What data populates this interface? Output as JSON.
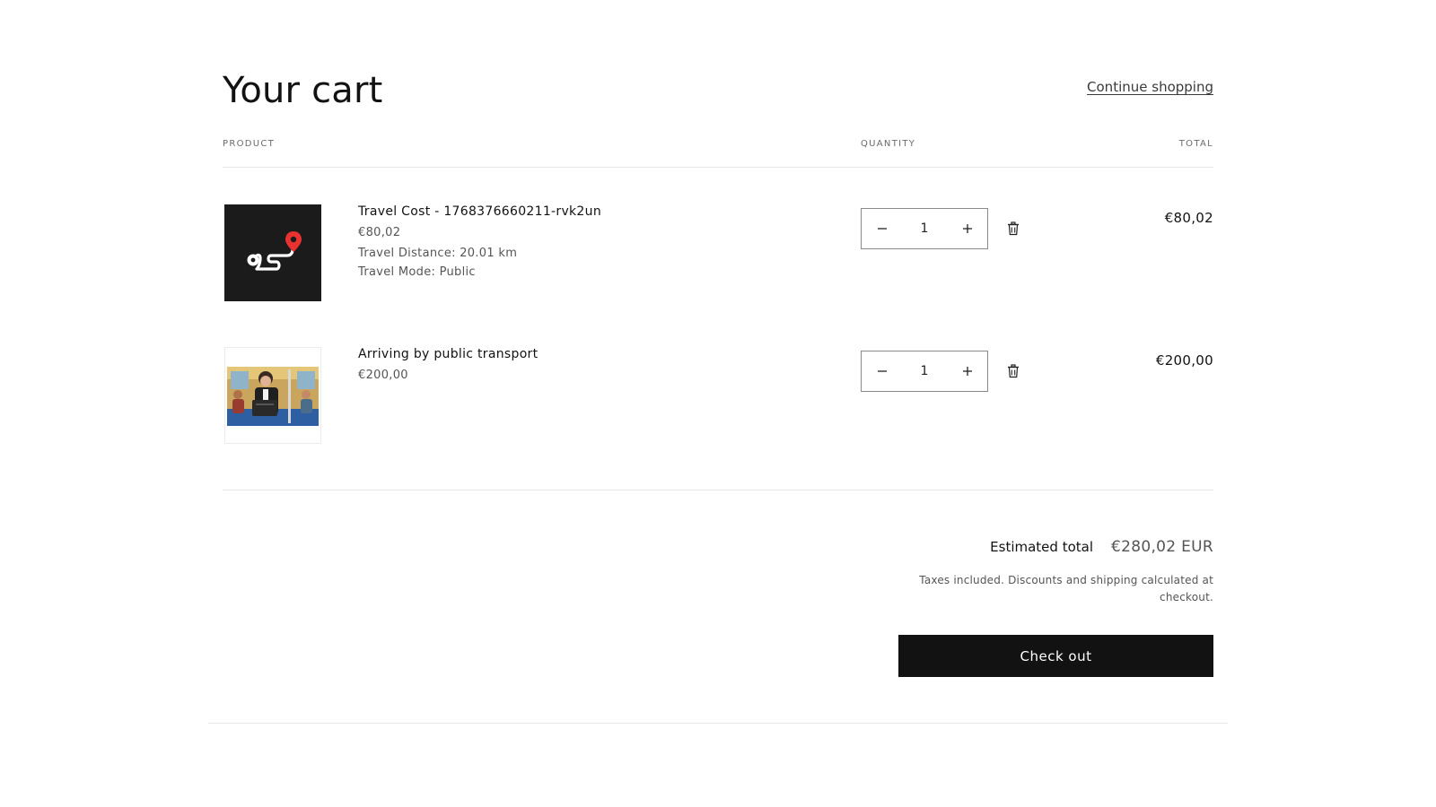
{
  "header": {
    "title": "Your cart",
    "continue_label": "Continue shopping"
  },
  "columns": {
    "product": "Product",
    "quantity": "Quantity",
    "total": "Total"
  },
  "items": [
    {
      "name": "Travel Cost - 1768376660211-rvk2un",
      "price": "€80,02",
      "properties": [
        "Travel Distance: 20.01 km",
        "Travel Mode: Public"
      ],
      "quantity": "1",
      "line_total": "€80,02",
      "image_icon": "route-pin-icon"
    },
    {
      "name": "Arriving by public transport",
      "price": "€200,00",
      "properties": [],
      "quantity": "1",
      "line_total": "€200,00",
      "image_icon": "train-passenger-illustration"
    }
  ],
  "summary": {
    "estimated_label": "Estimated total",
    "estimated_value": "€280,02 EUR",
    "tax_note": "Taxes included. Discounts and shipping calculated at checkout.",
    "checkout_label": "Check out"
  },
  "icons": {
    "decrease": "minus-icon",
    "increase": "plus-icon",
    "remove": "trash-icon"
  },
  "colors": {
    "text": "#121212",
    "muted": "#555555",
    "button_bg": "#121212",
    "button_text": "#ffffff",
    "pin_red": "#e8322f"
  }
}
